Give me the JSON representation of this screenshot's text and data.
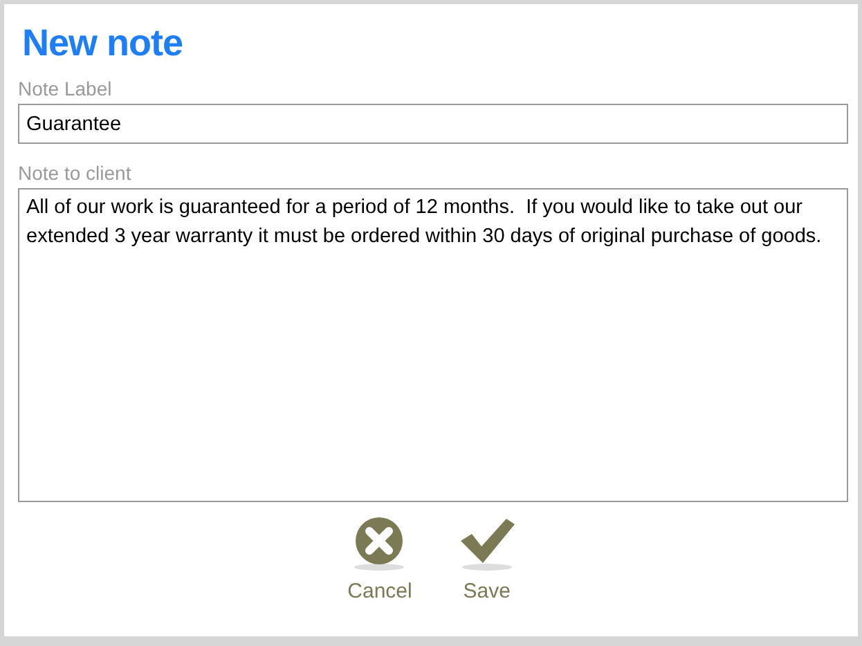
{
  "title": "New note",
  "fields": [
    {
      "label": "Note Label",
      "kind": "line",
      "value": "Guarantee"
    },
    {
      "label": "Note to client",
      "kind": "area",
      "value": "All of our work is guaranteed for a period of 12 months.  If you would like to take out our extended 3 year warranty it must be ordered within 30 days of original purchase of goods."
    }
  ],
  "buttons": [
    {
      "label": "Cancel",
      "kind": "cancel"
    },
    {
      "label": "Save",
      "kind": "save"
    }
  ]
}
